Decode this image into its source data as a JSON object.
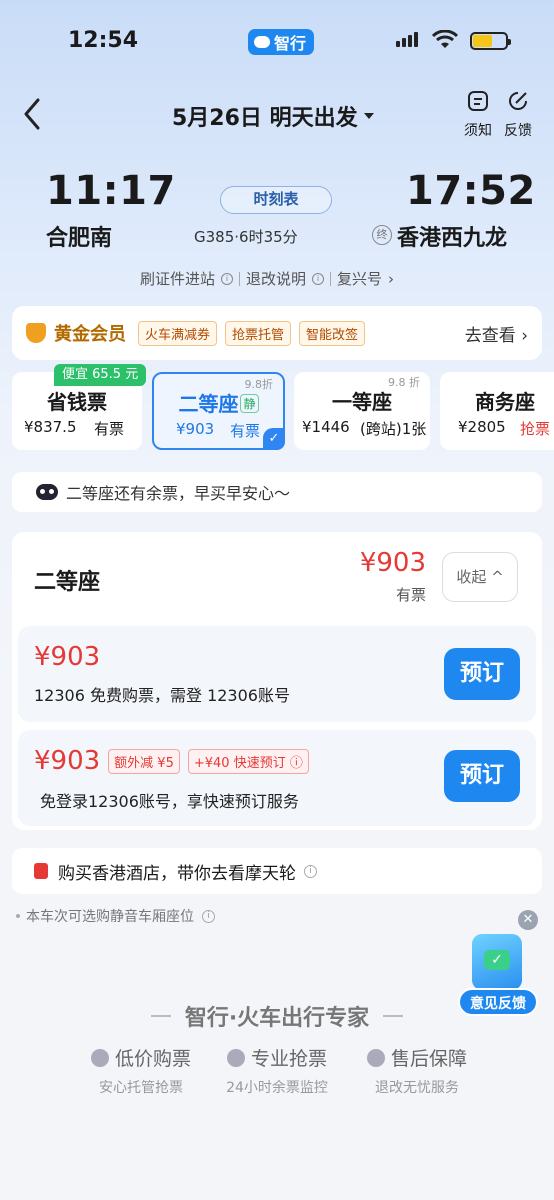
{
  "status": {
    "time": "12:54",
    "app_name": "智行"
  },
  "header": {
    "title": "5月26日 明天出发",
    "notice_label": "须知",
    "feedback_label": "反馈"
  },
  "train": {
    "depart_time": "11:17",
    "depart_station": "合肥南",
    "arrive_time": "17:52",
    "arrive_station": "香港西九龙",
    "terminal_badge": "终",
    "schedule_label": "时刻表",
    "train_info": "G385·6时35分",
    "links": [
      "刷证件进站",
      "退改说明",
      "复兴号"
    ]
  },
  "gold": {
    "title": "黄金会员",
    "tags": [
      "火车满减券",
      "抢票托管",
      "智能改签"
    ],
    "goto": "去查看"
  },
  "seats": {
    "save_badge": "便宜 65.5 元",
    "items": [
      {
        "name": "省钱票",
        "price": "¥837.5",
        "avail": "有票"
      },
      {
        "name": "二等座",
        "quiet": "静",
        "price": "¥903",
        "avail": "有票",
        "discount": "9.8折"
      },
      {
        "name": "一等座",
        "price": "¥1446",
        "avail": "(跨站)1张",
        "discount": "9.8 折"
      },
      {
        "name": "商务座",
        "price": "¥2805",
        "avail": "抢票"
      }
    ]
  },
  "tip": "二等座还有余票，早买早安心～",
  "detail": {
    "seat_title": "二等座",
    "price": "¥903",
    "avail": "有票",
    "collapse": "收起",
    "options": [
      {
        "price": "¥903",
        "desc": "12306 免费购票，需登 12306账号",
        "button": "预订"
      },
      {
        "price": "¥903",
        "tag1": "额外减 ¥5",
        "tag2": "+¥40 快速预订",
        "desc": "免登录12306账号，享快速预订服务",
        "button": "预订"
      }
    ]
  },
  "hotel": "购买香港酒店，带你去看摩天轮",
  "note": "本车次可选购静音车厢座位",
  "feedback_float": "意见反馈",
  "footer": {
    "brand": "智行·火车出行专家",
    "features": [
      {
        "title": "低价购票",
        "sub": "安心托管抢票"
      },
      {
        "title": "专业抢票",
        "sub": "24小时余票监控"
      },
      {
        "title": "售后保障",
        "sub": "退改无忧服务"
      }
    ]
  },
  "colors": {
    "accent": "#1e88f0",
    "price_red": "#e53935",
    "gold": "#b26a00",
    "green": "#2cc06a"
  }
}
